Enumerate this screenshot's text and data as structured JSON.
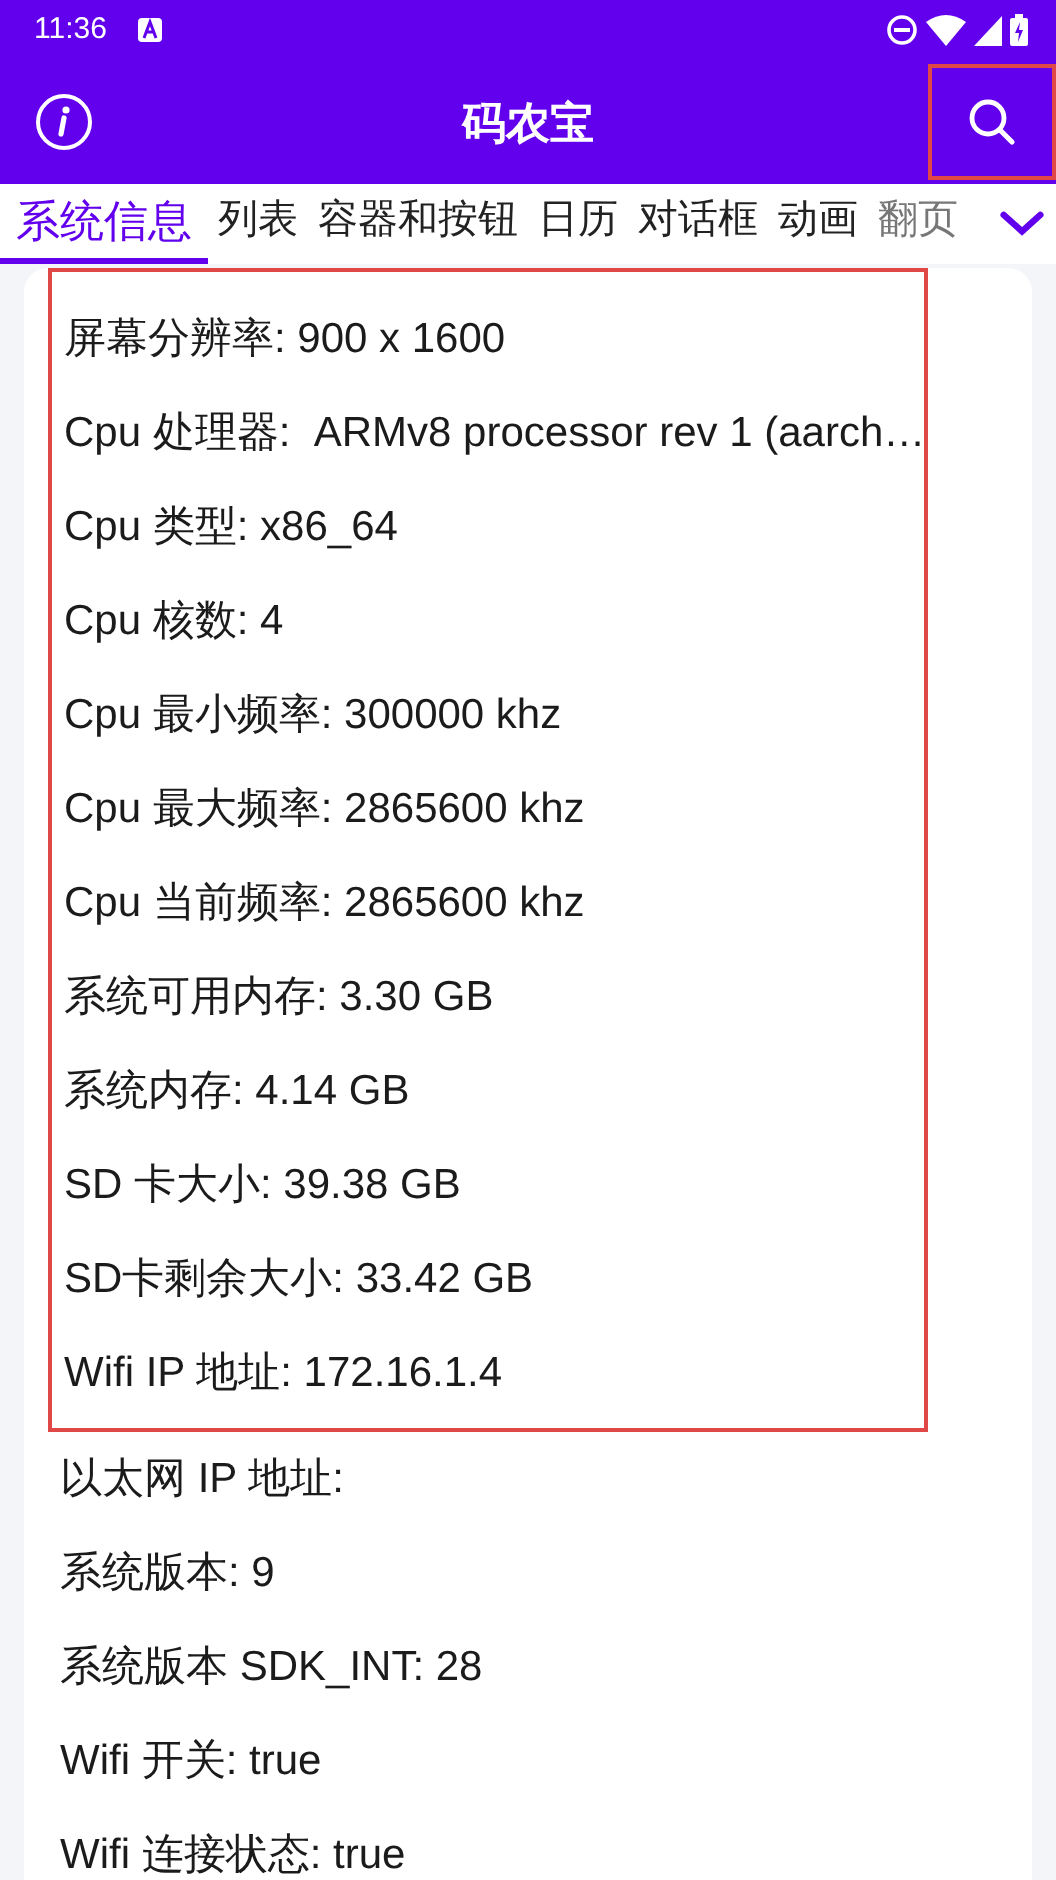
{
  "status_bar": {
    "time": "11:36"
  },
  "app_bar": {
    "title": "码农宝",
    "search_highlighted": true
  },
  "tabs": [
    {
      "label": "系统信息",
      "selected": true
    },
    {
      "label": "列表",
      "selected": false
    },
    {
      "label": "容器和按钮",
      "selected": false
    },
    {
      "label": "日历",
      "selected": false
    },
    {
      "label": "对话框",
      "selected": false
    },
    {
      "label": "动画",
      "selected": false
    },
    {
      "label": "翻页",
      "selected": false
    }
  ],
  "info_rows": [
    {
      "text": "屏幕分辨率: 900 x 1600",
      "highlighted": true
    },
    {
      "text": "Cpu 处理器:  ARMv8 processor rev 1 (aarch…",
      "highlighted": true
    },
    {
      "text": "Cpu 类型: x86_64",
      "highlighted": true
    },
    {
      "text": "Cpu 核数: 4",
      "highlighted": true
    },
    {
      "text": "Cpu 最小频率: 300000 khz",
      "highlighted": true
    },
    {
      "text": "Cpu 最大频率: 2865600 khz",
      "highlighted": true
    },
    {
      "text": "Cpu 当前频率: 2865600 khz",
      "highlighted": true
    },
    {
      "text": "系统可用内存: 3.30 GB",
      "highlighted": true
    },
    {
      "text": "系统内存: 4.14 GB",
      "highlighted": true
    },
    {
      "text": "SD 卡大小: 39.38 GB",
      "highlighted": true
    },
    {
      "text": "SD卡剩余大小: 33.42 GB",
      "highlighted": true
    },
    {
      "text": "Wifi IP 地址: 172.16.1.4",
      "highlighted": true
    },
    {
      "text": "以太网 IP 地址:",
      "highlighted": false
    },
    {
      "text": "系统版本: 9",
      "highlighted": false
    },
    {
      "text": "系统版本 SDK_INT: 28",
      "highlighted": false
    },
    {
      "text": "Wifi 开关: true",
      "highlighted": false
    },
    {
      "text": "Wifi 连接状态: true",
      "highlighted": false
    }
  ]
}
